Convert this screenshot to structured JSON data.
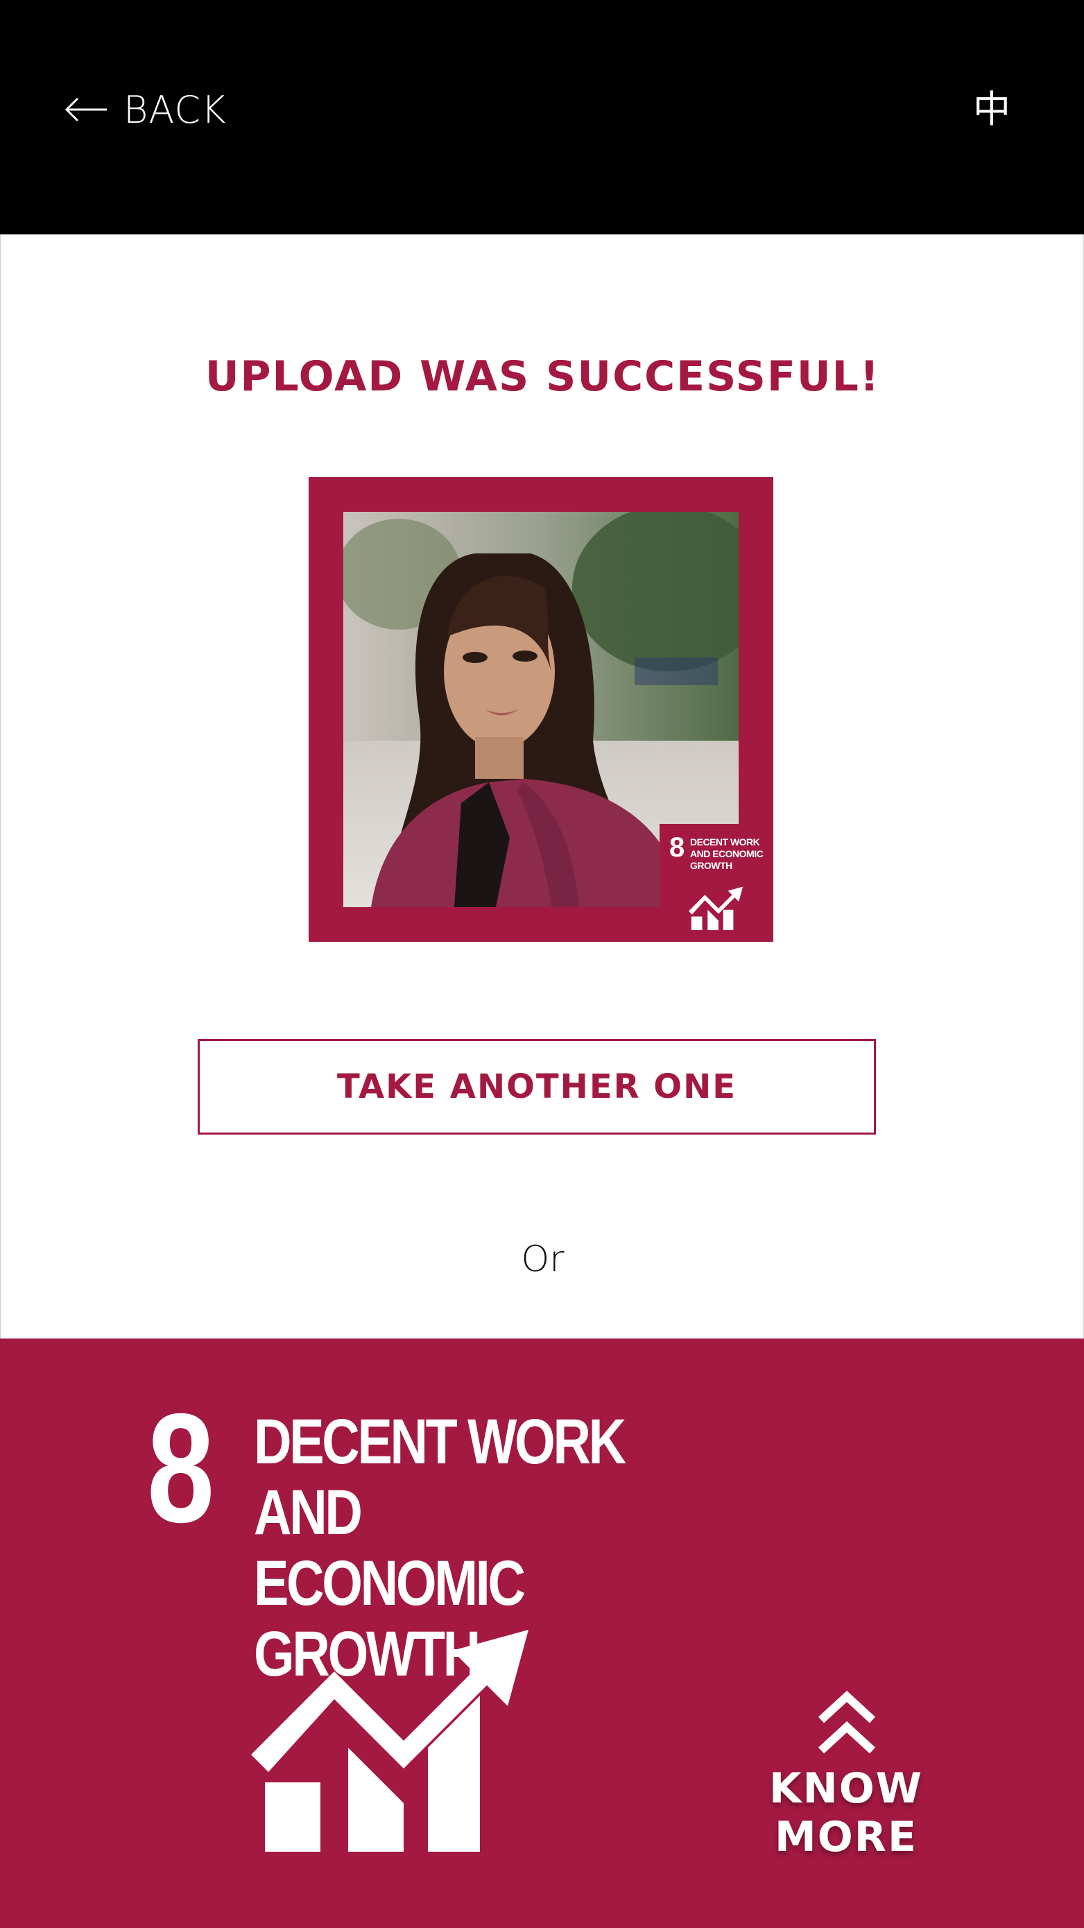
{
  "header": {
    "back_label": "BACK",
    "language_label": "中"
  },
  "main": {
    "title": "UPLOAD WAS SUCCESSFUL!",
    "photo_badge": {
      "number": "8",
      "text": "DECENT WORK AND ECONOMIC GROWTH"
    },
    "take_another_label": "TAKE ANOTHER ONE",
    "or_label": "Or"
  },
  "goal": {
    "number": "8",
    "title_line1": "DECENT WORK AND",
    "title_line2": "ECONOMIC GROWTH",
    "know_more_label": "KNOW MORE",
    "icon": "growth-chart-icon"
  },
  "colors": {
    "brand": "#a31942",
    "header_bg": "#000000",
    "text_light": "#ffffff"
  }
}
